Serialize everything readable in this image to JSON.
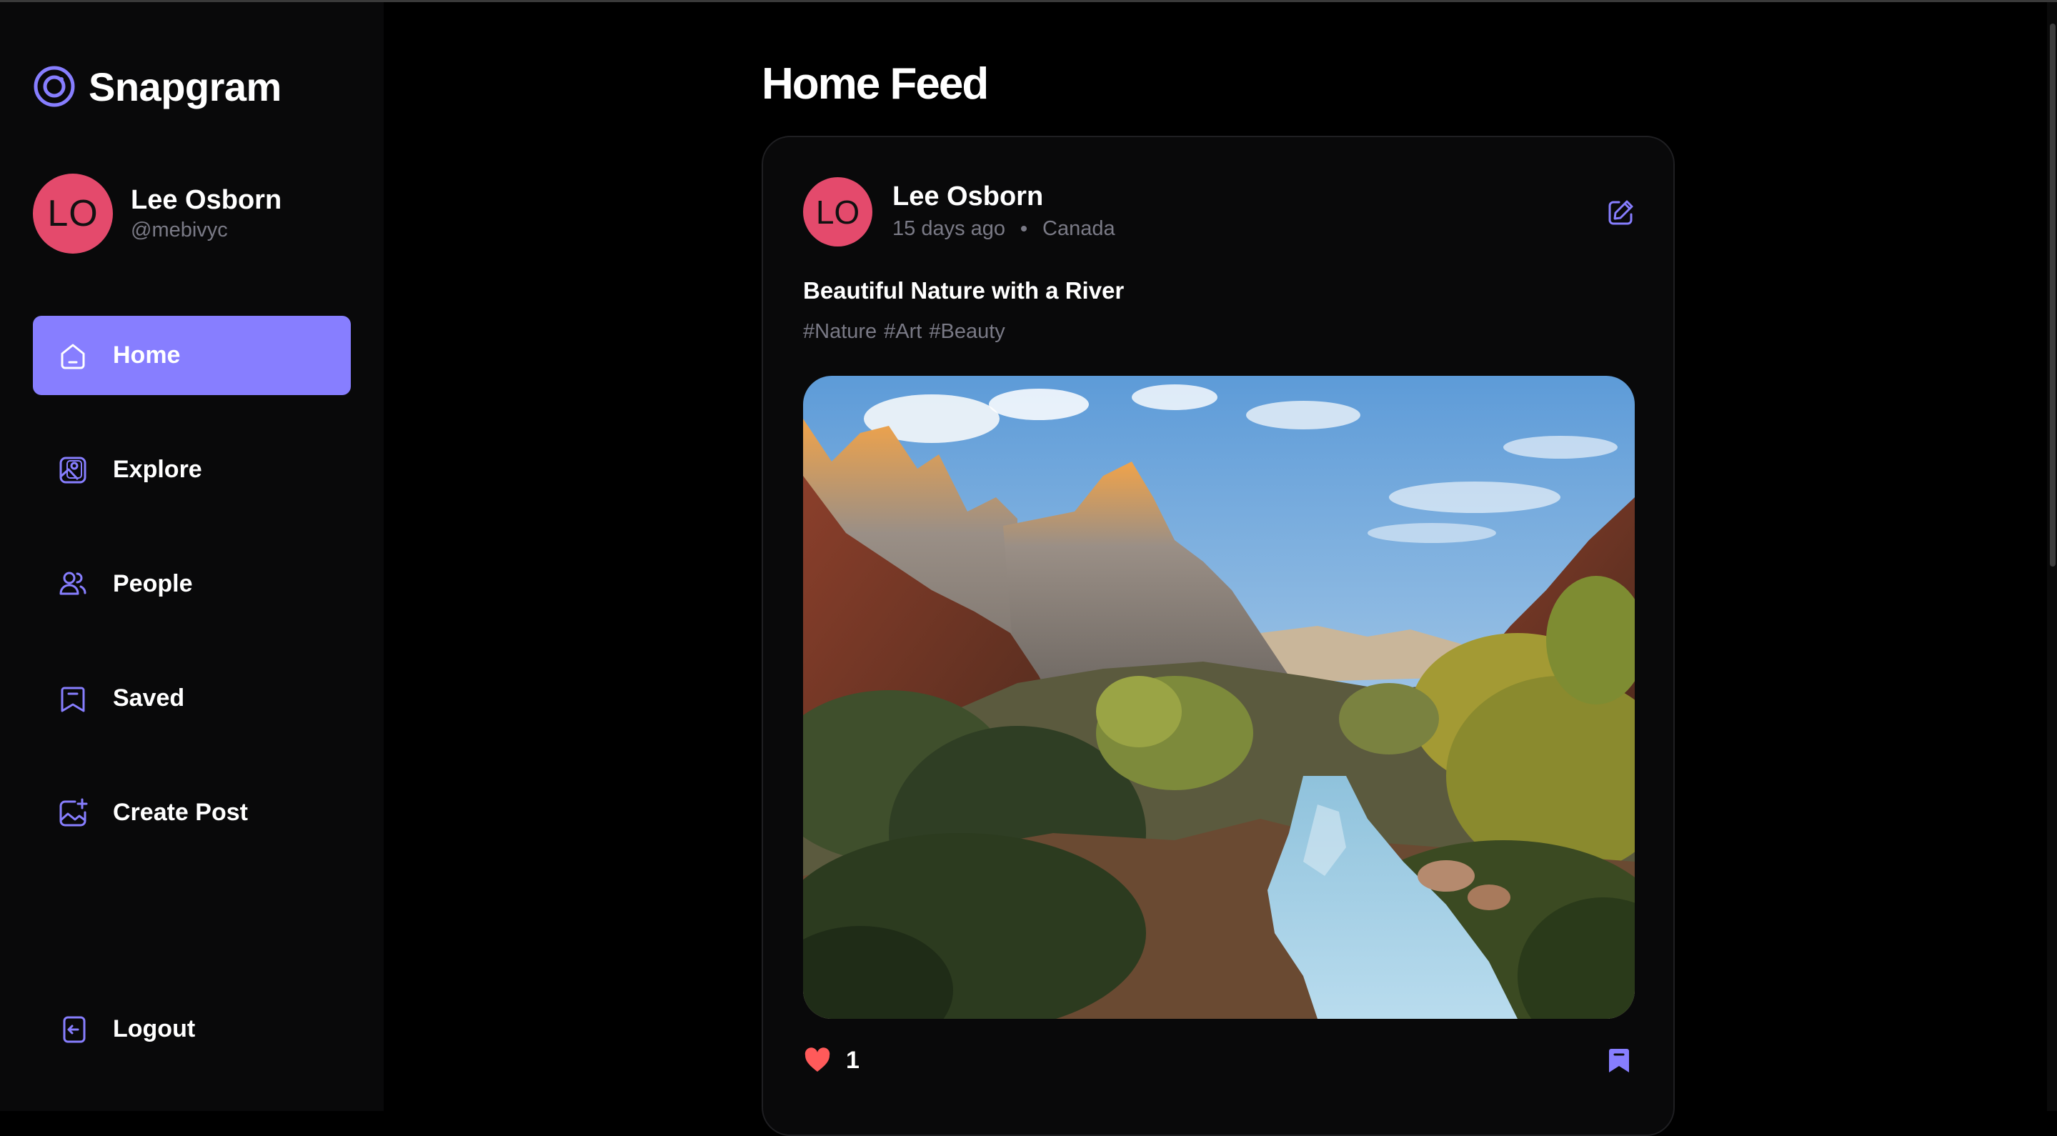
{
  "app": {
    "name": "Snapgram"
  },
  "user": {
    "initials": "LO",
    "name": "Lee Osborn",
    "handle": "@mebivyc"
  },
  "sidebar": {
    "items": [
      {
        "label": "Home",
        "icon": "home-icon",
        "active": true
      },
      {
        "label": "Explore",
        "icon": "gallery-icon",
        "active": false
      },
      {
        "label": "People",
        "icon": "people-icon",
        "active": false
      },
      {
        "label": "Saved",
        "icon": "bookmark-icon",
        "active": false
      },
      {
        "label": "Create Post",
        "icon": "gallery-add-icon",
        "active": false
      }
    ],
    "logout_label": "Logout"
  },
  "main": {
    "title": "Home Feed"
  },
  "post": {
    "author_initials": "LO",
    "author": "Lee Osborn",
    "time": "15 days ago",
    "location": "Canada",
    "caption": "Beautiful Nature with a River",
    "tags": [
      "#Nature",
      "#Art",
      "#Beauty"
    ],
    "image_alt": "mountain valley with a river and autumn trees",
    "likes": "1",
    "liked": true,
    "saved": true
  },
  "colors": {
    "accent": "#877eff",
    "avatar": "#e44a6c",
    "muted": "#7a7a86",
    "like": "#ff5a5a",
    "background": "#000000",
    "sidebar": "#09090a"
  }
}
